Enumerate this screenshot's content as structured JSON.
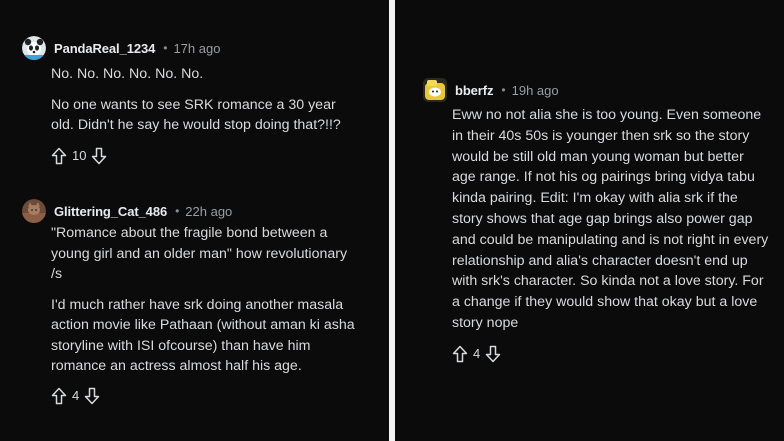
{
  "left_panel": {
    "comments": [
      {
        "username": "PandaReal_1234",
        "separator": "•",
        "time": "17h ago",
        "paragraphs": [
          "No. No. No. No. No. No.",
          "No one wants to see SRK romance a 30 year old. Didn't he say he would stop doing that?!!?"
        ],
        "score": "10",
        "avatar_icon": "panda-avatar-icon"
      },
      {
        "username": "Glittering_Cat_486",
        "separator": "•",
        "time": "22h ago",
        "paragraphs": [
          "\"Romance about the fragile bond between a young girl and an older man\" how revolutionary /s",
          "I'd much rather have srk doing another masala action movie like Pathaan (without aman ki asha storyline with ISI ofcourse) than have him romance an actress almost half his age."
        ],
        "score": "4",
        "avatar_icon": "cat-avatar-icon"
      }
    ]
  },
  "right_panel": {
    "comments": [
      {
        "username": "bberfz",
        "separator": "•",
        "time": "19h ago",
        "paragraphs": [
          "Eww no not alia she is too young. Even someone in their 40s 50s is younger then srk so the story would be still old man young woman but better age range. If not his og pairings bring vidya tabu kinda pairing. Edit: I'm okay with alia srk if the story shows that age gap brings also power gap and could be manipulating and is not right in every relationship and alia's character doesn't end up with srk's character. So kinda not a love story. For a change if they would show that okay but a love story nope"
        ],
        "score": "4",
        "avatar_icon": "snoo-avatar-icon"
      }
    ]
  },
  "colors": {
    "background": "#0b0b0c",
    "text": "#d8dadc",
    "muted": "#9a9da0",
    "divider": "#f4f4f4"
  }
}
